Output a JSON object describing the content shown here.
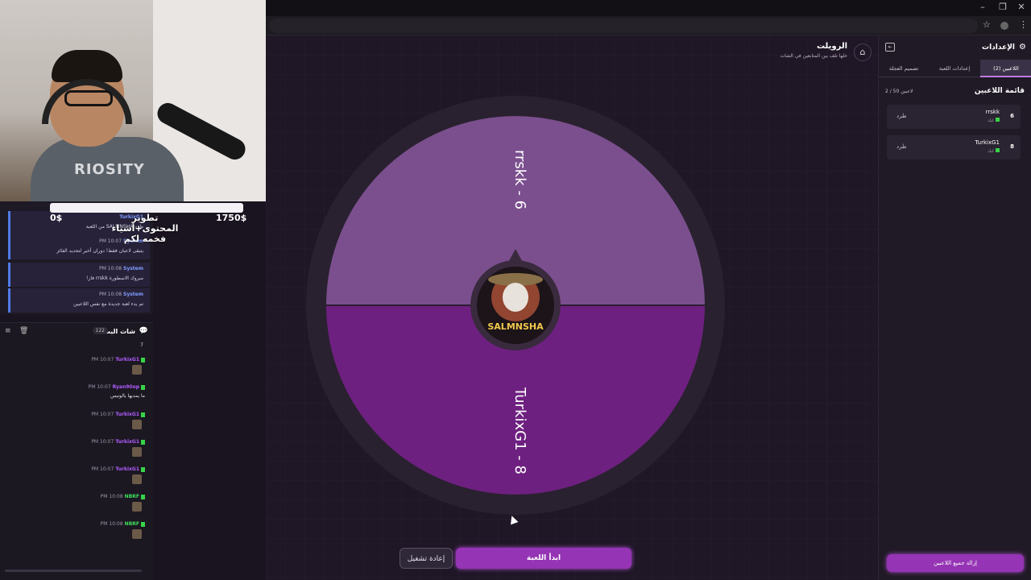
{
  "browser": {
    "win_min": "–",
    "win_max": "❐",
    "win_close": "✕",
    "star_icon": "☆",
    "menu_icon": "⋮"
  },
  "stream_overlay": {
    "webcam_shirt_text": "RIOSITY",
    "progress_left": "0$",
    "progress_right": "1750$",
    "goal_text": "تطوير المحتوى+أشياء فخمه لكم"
  },
  "system_feed": [
    {
      "name": "TurkixG1",
      "time": "",
      "text": "طرد SALMNSHA من اللعبة"
    },
    {
      "name": "System",
      "time": "PM 10:07",
      "text": "يتبقى لاعبان فقط! دوران أخير لتحديد الفائز"
    },
    {
      "name": "System",
      "time": "PM 10:08",
      "text": "مبروك الاسطورة rrskk فاز!"
    },
    {
      "name": "System",
      "time": "PM 10:08",
      "text": "تم بدء لعبة جديدة مع نفس اللاعبين"
    }
  ],
  "chat": {
    "title": "شات البث",
    "count": "122",
    "first_line": "7",
    "messages": [
      {
        "time": "PM 10:07",
        "user": "TurkixG1",
        "color": "#b05cff",
        "text": "",
        "emote": true
      },
      {
        "time": "PM 10:07",
        "user": "Ryan90op",
        "color": "#b05cff",
        "text": "ما يمديها يالونيس",
        "emote": false
      },
      {
        "time": "PM 10:07",
        "user": "TurkixG1",
        "color": "#b05cff",
        "text": "",
        "emote": true
      },
      {
        "time": "PM 10:07",
        "user": "TurkixG1",
        "color": "#b05cff",
        "text": "",
        "emote": true
      },
      {
        "time": "PM 10:07",
        "user": "TurkixG1",
        "color": "#b05cff",
        "text": "",
        "emote": true
      },
      {
        "time": "PM 10:08",
        "user": "NBRF",
        "color": "#3ee05c",
        "text": "",
        "emote": true
      },
      {
        "time": "PM 10:08",
        "user": "NBRF",
        "color": "#3ee05c",
        "text": "",
        "emote": true
      }
    ]
  },
  "main": {
    "title": "الرويلت",
    "subtitle": "خلها تلف بين المتابعين في الشات",
    "home_icon": "⌂",
    "wheel": {
      "segments": [
        {
          "label": "rrskk - 6",
          "color": "#7b4f8e"
        },
        {
          "label": "TurkixG1 - 8",
          "color": "#6e2080"
        }
      ],
      "center_logo": "SALMNSHA",
      "outer_ring": "#2a2130"
    },
    "restart_label": "إعادة تشغيل",
    "start_label": "ابدأ اللعبة"
  },
  "side": {
    "title": "الإعدادات",
    "gear_icon": "⚙",
    "collapse_icon": "⇤",
    "tabs": [
      "اللاعبين (2)",
      "إعدادات اللعبة",
      "تصميم العجلة"
    ],
    "list_title": "قائمة اللاعبين",
    "list_count": "2 / 50 لاعبين",
    "players": [
      {
        "num": "6",
        "name": "rrskk",
        "sub": "كيك",
        "kick": "طرد"
      },
      {
        "num": "8",
        "name": "TurkixG1",
        "sub": "كيك",
        "kick": "طرد"
      }
    ],
    "remove_all": "إزالة جميع اللاعبين"
  }
}
